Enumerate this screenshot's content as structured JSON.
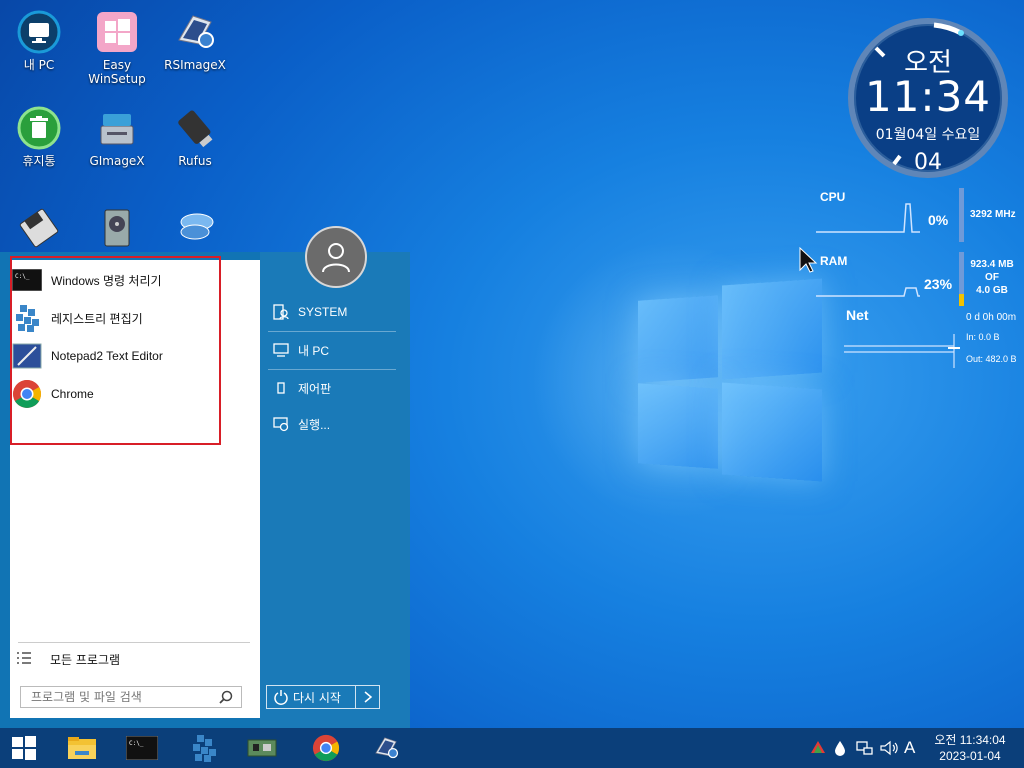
{
  "desktop": {
    "icons": [
      {
        "label": "내 PC"
      },
      {
        "label": "Easy WinSetup"
      },
      {
        "label": "RSImageX"
      },
      {
        "label": "휴지통"
      },
      {
        "label": "GImageX"
      },
      {
        "label": "Rufus"
      },
      {
        "label": ""
      },
      {
        "label": ""
      },
      {
        "label": ""
      }
    ]
  },
  "clock": {
    "ampm": "오전",
    "time": "11:34",
    "date": "01월04일 수요일",
    "day": "04"
  },
  "monitor": {
    "cpu_label": "CPU",
    "cpu_percent": "0%",
    "cpu_freq": "3292 MHz",
    "ram_label": "RAM",
    "ram_percent": "23%",
    "ram_used": "923.4 MB",
    "ram_of": "OF",
    "ram_total": "4.0 GB",
    "ram_fill": 0.23,
    "net_label": "Net",
    "uptime": "0 d 0h 00m",
    "net_in": "In: 0.0 B",
    "net_out": "Out: 482.0 B"
  },
  "start_menu": {
    "programs": [
      {
        "label": "Windows 명령 처리기",
        "icon": "cmd-icon"
      },
      {
        "label": "레지스트리 편집기",
        "icon": "regedit-icon"
      },
      {
        "label": "Notepad2 Text Editor",
        "icon": "notepad2-icon"
      },
      {
        "label": "Chrome",
        "icon": "chrome-icon"
      }
    ],
    "all_programs": "모든 프로그램",
    "search_placeholder": "프로그램 및 파일 검색",
    "right_items": [
      {
        "label": "SYSTEM",
        "icon": "user-folder-icon"
      },
      {
        "label": "내 PC",
        "icon": "computer-icon"
      },
      {
        "label": "제어판",
        "icon": "control-panel-icon"
      },
      {
        "label": "실행...",
        "icon": "run-icon"
      }
    ],
    "restart_label": "다시 시작"
  },
  "taskbar": {
    "tray_ime": "A",
    "tray_time": "오전 11:34:04",
    "tray_date": "2023-01-04"
  },
  "colors": {
    "accent": "#0b3f7a",
    "highlight": "#d81e27"
  }
}
